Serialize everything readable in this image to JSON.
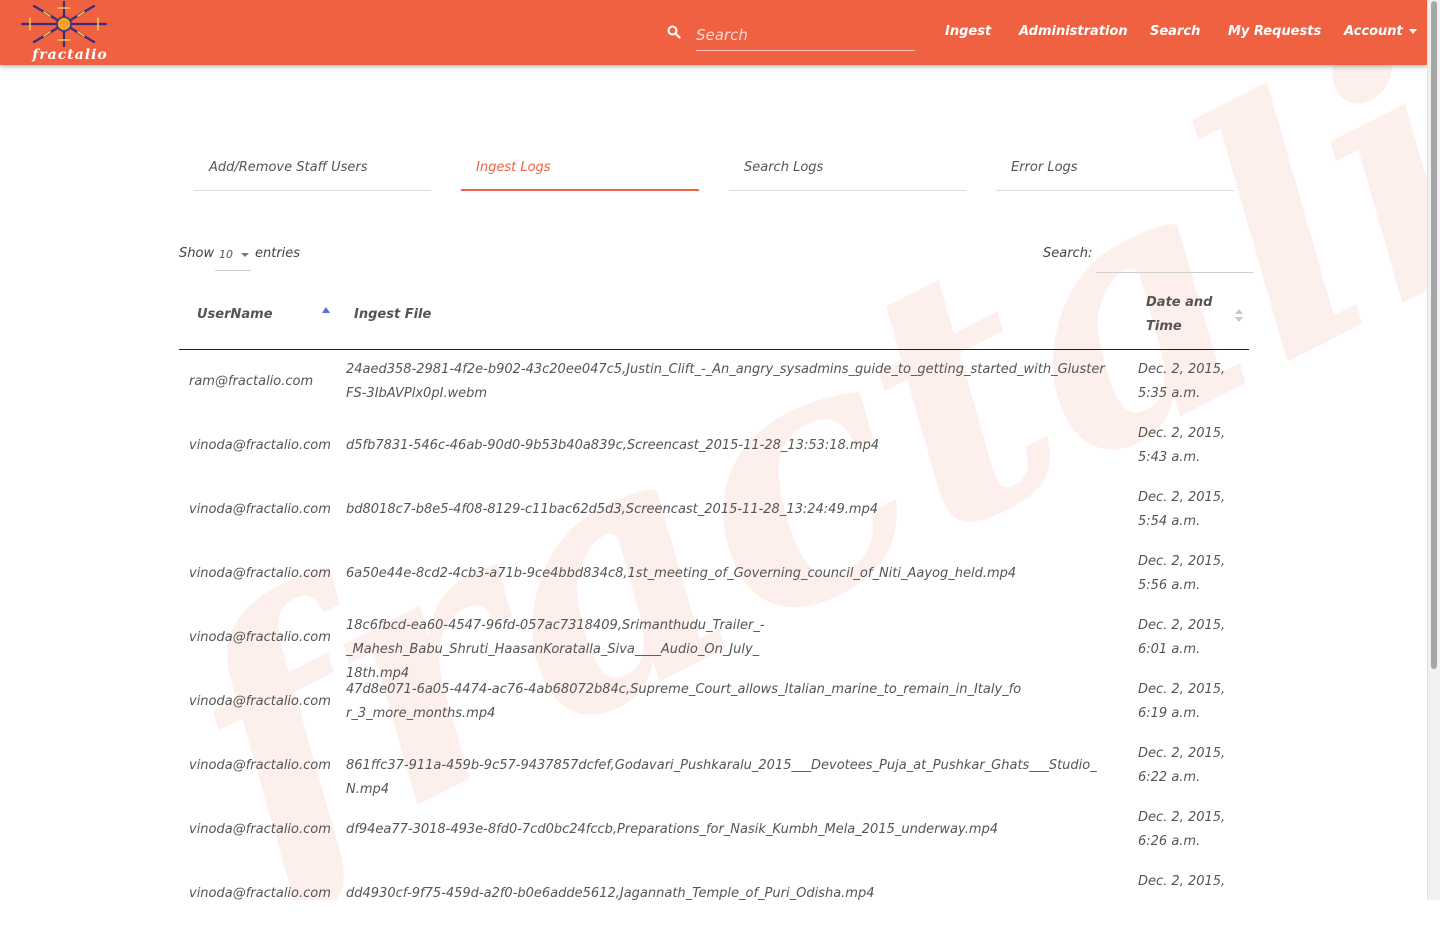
{
  "brand": {
    "name": "fractalio"
  },
  "nav": {
    "search_placeholder": "Search",
    "links": [
      "Ingest",
      "Administration",
      "Search",
      "My Requests"
    ],
    "account_label": "Account"
  },
  "tabs": [
    {
      "label": "Add/Remove Staff Users"
    },
    {
      "label": "Ingest Logs"
    },
    {
      "label": "Search Logs"
    },
    {
      "label": "Error Logs"
    }
  ],
  "active_tab": "Ingest Logs",
  "table_controls": {
    "show_label": "Show",
    "page_length": "10",
    "entries_label": "entries",
    "search_label": "Search:"
  },
  "table": {
    "headers": [
      "UserName",
      "Ingest File",
      "Date and Time"
    ],
    "rows": [
      [
        "ram@fractalio.com",
        "24aed358-2981-4f2e-b902-43c20ee047c5,Justin_Clift_-_An_angry_sysadmins_guide_to_getting_started_with_GlusterFS-3IbAVPlx0pI.webm",
        "Dec. 2, 2015, 5:35 a.m."
      ],
      [
        "vinoda@fractalio.com",
        "d5fb7831-546c-46ab-90d0-9b53b40a839c,Screencast_2015-11-28_13:53:18.mp4",
        "Dec. 2, 2015, 5:43 a.m."
      ],
      [
        "vinoda@fractalio.com",
        "bd8018c7-b8e5-4f08-8129-c11bac62d5d3,Screencast_2015-11-28_13:24:49.mp4",
        "Dec. 2, 2015, 5:54 a.m."
      ],
      [
        "vinoda@fractalio.com",
        "6a50e44e-8cd2-4cb3-a71b-9ce4bbd834c8,1st_meeting_of_Governing_council_of_Niti_Aayog_held.mp4",
        "Dec. 2, 2015, 5:56 a.m."
      ],
      [
        "vinoda@fractalio.com",
        "18c6fbcd-ea60-4547-96fd-057ac7318409,Srimanthudu_Trailer_-_Mahesh_Babu_Shruti_HaasanKoratalla_Siva____Audio_On_July_18th.mp4",
        "Dec. 2, 2015, 6:01 a.m."
      ],
      [
        "vinoda@fractalio.com",
        "47d8e071-6a05-4474-ac76-4ab68072b84c,Supreme_Court_allows_Italian_marine_to_remain_in_Italy_for_3_more_months.mp4",
        "Dec. 2, 2015, 6:19 a.m."
      ],
      [
        "vinoda@fractalio.com",
        "861ffc37-911a-459b-9c57-9437857dcfef,Godavari_Pushkaralu_2015___Devotees_Puja_at_Pushkar_Ghats___Studio_N.mp4",
        "Dec. 2, 2015, 6:22 a.m."
      ],
      [
        "vinoda@fractalio.com",
        "df94ea77-3018-493e-8fd0-7cd0bc24fccb,Preparations_for_Nasik_Kumbh_Mela_2015_underway.mp4",
        "Dec. 2, 2015, 6:26 a.m."
      ],
      [
        "vinoda@fractalio.com",
        "dd4930cf-9f75-459d-a2f0-b0e6adde5612,Jagannath_Temple_of_Puri_Odisha.mp4",
        "Dec. 2, 2015,"
      ]
    ]
  },
  "colors": {
    "brand": "#f06141",
    "sort_active": "#5b6ee1",
    "watermark": "#fde3dd"
  }
}
